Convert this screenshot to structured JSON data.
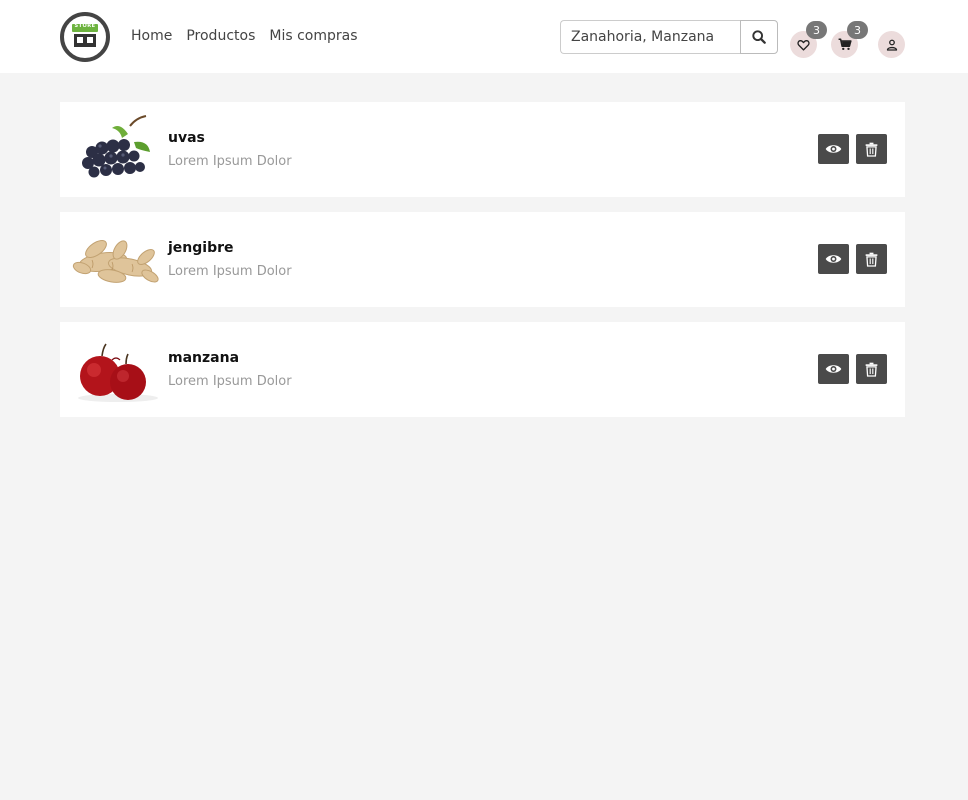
{
  "brand": {
    "logo_text": "STORE"
  },
  "nav": {
    "links": [
      "Home",
      "Productos",
      "Mis compras"
    ]
  },
  "search": {
    "value": "Zanahoria, Manzana",
    "placeholder": "Zanahoria, Manzana"
  },
  "header_icons": {
    "wishlist_count": "3",
    "cart_count": "3"
  },
  "products": [
    {
      "name": "uvas",
      "description": "Lorem Ipsum Dolor",
      "image": "grapes"
    },
    {
      "name": "jengibre",
      "description": "Lorem Ipsum Dolor",
      "image": "ginger"
    },
    {
      "name": "manzana",
      "description": "Lorem Ipsum Dolor",
      "image": "apples"
    }
  ],
  "colors": {
    "accent_dark": "#4a4a4a",
    "badge": "#777777",
    "icon_bg": "#ecdcdc",
    "page_bg": "#f4f4f4"
  }
}
